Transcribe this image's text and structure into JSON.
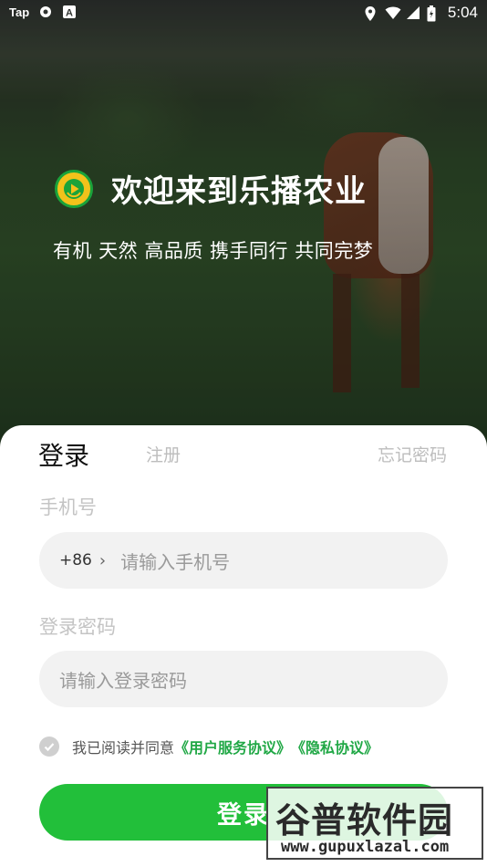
{
  "status_bar": {
    "tap_label": "Tap",
    "time": "5:04",
    "icons": [
      "tap-icon",
      "settings-icon",
      "a-icon",
      "location-icon",
      "wifi-icon",
      "signal-icon",
      "battery-icon"
    ]
  },
  "brand": {
    "title": "欢迎来到乐播农业",
    "slogan": "有机 天然 高品质 携手同行 共同完梦",
    "logo_icon": "play-icon"
  },
  "tabs": {
    "login": "登录",
    "register": "注册"
  },
  "forgot": "忘记密码",
  "phone": {
    "label": "手机号",
    "country_code": "+86",
    "placeholder": "请输入手机号"
  },
  "password": {
    "label": "登录密码",
    "placeholder": "请输入登录密码"
  },
  "agreement": {
    "prefix": "我已阅读并同意",
    "terms": "《用户服务协议》",
    "privacy": "《隐私协议》"
  },
  "login_button": "登录",
  "watermark": {
    "line1": "谷普软件园",
    "line2": "www.gupuxlazal.com"
  },
  "colors": {
    "accent": "#22bf3a",
    "link": "#21a846",
    "logo_yellow": "#f2c21b"
  }
}
